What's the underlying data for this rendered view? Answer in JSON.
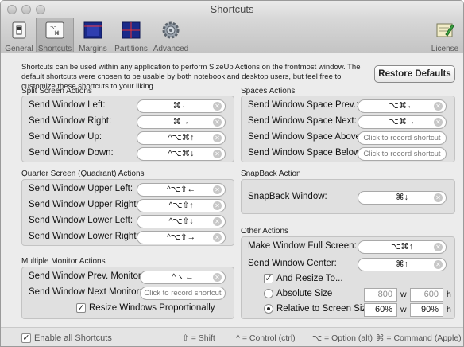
{
  "window": {
    "title": "Shortcuts"
  },
  "toolbar": {
    "items": [
      {
        "label": "General",
        "icon": "switch-icon"
      },
      {
        "label": "Shortcuts",
        "icon": "keyboard-icon"
      },
      {
        "label": "Margins",
        "icon": "margins-icon"
      },
      {
        "label": "Partitions",
        "icon": "partitions-icon"
      },
      {
        "label": "Advanced",
        "icon": "gear-icon"
      },
      {
        "label": "License",
        "icon": "license-icon"
      }
    ]
  },
  "intro": {
    "text": "Shortcuts can be used within any application to perform SizeUp Actions on the frontmost window. The default shortcuts were chosen to be usable by both notebook and desktop users, but feel free to customize these shortcuts to your liking."
  },
  "restore_button": "Restore Defaults",
  "split_screen": {
    "title": "Split Screen Actions",
    "rows": [
      {
        "label": "Send Window Left:",
        "shortcut": "⌘←"
      },
      {
        "label": "Send Window Right:",
        "shortcut": "⌘→"
      },
      {
        "label": "Send Window Up:",
        "shortcut": "^⌥⌘↑"
      },
      {
        "label": "Send Window Down:",
        "shortcut": "^⌥⌘↓"
      }
    ]
  },
  "quarter_screen": {
    "title": "Quarter Screen (Quadrant) Actions",
    "rows": [
      {
        "label": "Send Window Upper Left:",
        "shortcut": "^⌥⇧←"
      },
      {
        "label": "Send Window Upper Right:",
        "shortcut": "^⌥⇧↑"
      },
      {
        "label": "Send Window Lower Left:",
        "shortcut": "^⌥⇧↓"
      },
      {
        "label": "Send Window Lower Right:",
        "shortcut": "^⌥⇧→"
      }
    ]
  },
  "multi_monitor": {
    "title": "Multiple Monitor Actions",
    "rows": [
      {
        "label": "Send Window Prev. Monitor:",
        "shortcut": "^⌥←"
      },
      {
        "label": "Send Window Next Monitor:",
        "placeholder": "Click to record shortcut"
      }
    ],
    "resize_checkbox": "Resize Windows Proportionally"
  },
  "spaces": {
    "title": "Spaces Actions",
    "rows": [
      {
        "label": "Send Window Space Prev.:",
        "shortcut": "⌥⌘←"
      },
      {
        "label": "Send Window Space Next:",
        "shortcut": "⌥⌘→"
      },
      {
        "label": "Send Window Space Above:",
        "placeholder": "Click to record shortcut"
      },
      {
        "label": "Send Window Space Below:",
        "placeholder": "Click to record shortcut"
      }
    ]
  },
  "snapback": {
    "title": "SnapBack Action",
    "rows": [
      {
        "label": "SnapBack Window:",
        "shortcut": "⌘↓"
      }
    ]
  },
  "other": {
    "title": "Other Actions",
    "rows": [
      {
        "label": "Make Window Full Screen:",
        "shortcut": "⌥⌘↑"
      },
      {
        "label": "Send Window Center:",
        "shortcut": "⌘↑"
      }
    ],
    "and_resize": "And Resize To...",
    "absolute_size": {
      "label": "Absolute Size",
      "w": "800",
      "h": "600",
      "w_unit": "w",
      "h_unit": "h"
    },
    "relative_size": {
      "label": "Relative to Screen Size",
      "w": "60%",
      "h": "90%",
      "w_unit": "w",
      "h_unit": "h"
    }
  },
  "bottom": {
    "enable_all": "Enable all Shortcuts",
    "legend": [
      "⇧ = Shift",
      "^ = Control (ctrl)",
      "⌥ = Option (alt)",
      "⌘ = Command (Apple)"
    ]
  },
  "colors": {
    "window_bg": "#ececec",
    "group_bg": "#e0e0e0",
    "field_bg": "#ffffff"
  }
}
